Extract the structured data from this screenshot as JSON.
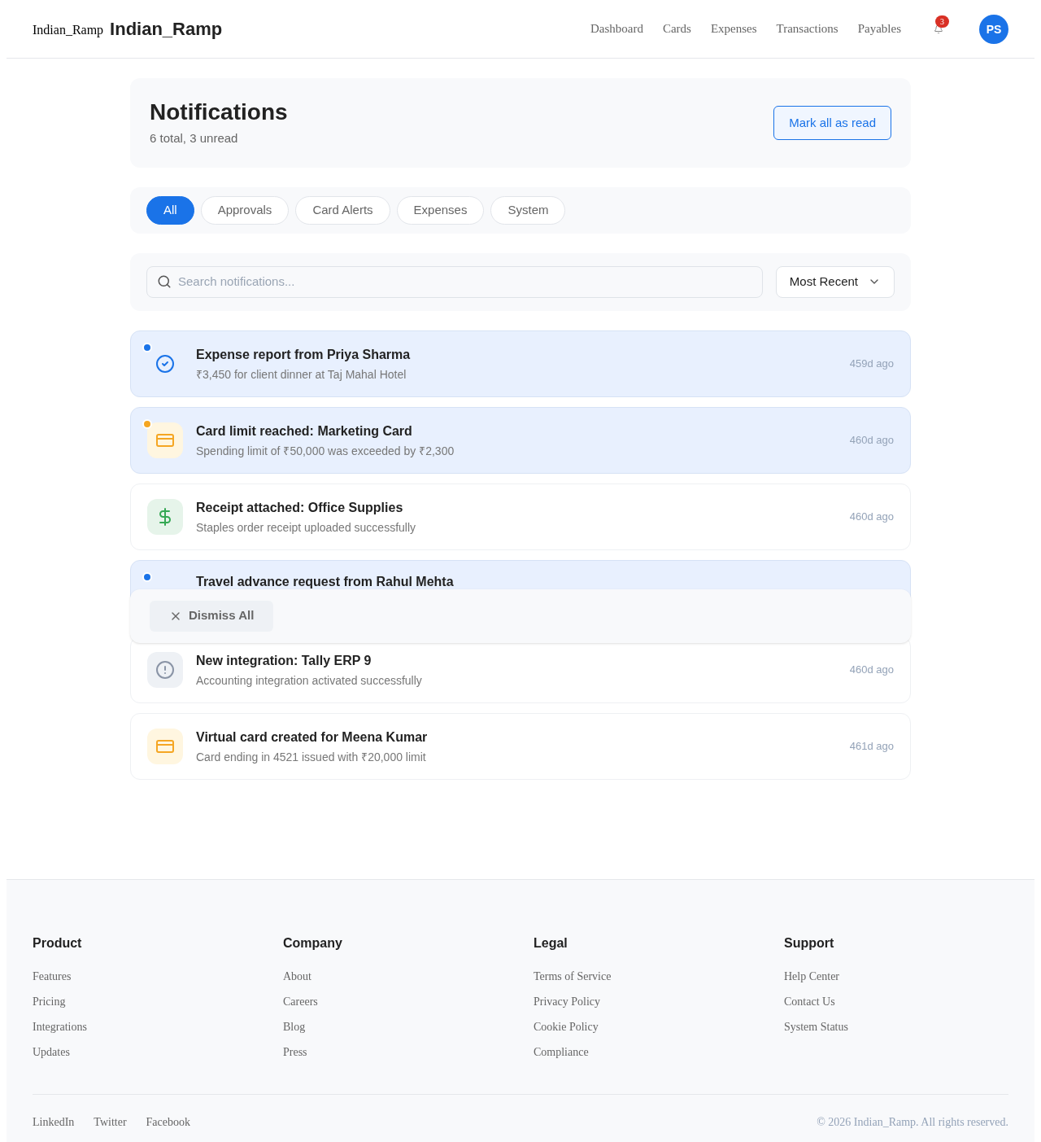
{
  "header": {
    "logo_alt": "Indian_Ramp",
    "brand": "Indian_Ramp",
    "nav": [
      "Dashboard",
      "Cards",
      "Expenses",
      "Transactions",
      "Payables"
    ],
    "notification_count": "3",
    "avatar": "PS"
  },
  "page": {
    "title": "Notifications",
    "subtitle": "6 total, 3 unread",
    "mark_all": "Mark all as read"
  },
  "filters": [
    {
      "label": "All",
      "selected": true
    },
    {
      "label": "Approvals",
      "selected": false
    },
    {
      "label": "Card Alerts",
      "selected": false
    },
    {
      "label": "Expenses",
      "selected": false
    },
    {
      "label": "System",
      "selected": false
    }
  ],
  "search": {
    "placeholder": "Search notifications..."
  },
  "sort": {
    "value": "Most Recent"
  },
  "notifications": [
    {
      "unread": true,
      "color": "#1a73e8",
      "kind": "check",
      "title": "Expense report from Priya Sharma",
      "description": "₹3,450 for client dinner at Taj Mahal Hotel",
      "time": "459d ago"
    },
    {
      "unread": true,
      "color": "#f5a623",
      "kind": "card",
      "title": "Card limit reached: Marketing Card",
      "description": "Spending limit of ₹50,000 was exceeded by ₹2,300",
      "time": "460d ago"
    },
    {
      "unread": false,
      "kind": "dollar",
      "title": "Receipt attached: Office Supplies",
      "description": "Staples order receipt uploaded successfully",
      "time": "460d ago"
    },
    {
      "unread": true,
      "color": "#1a73e8",
      "title": "Travel advance request from Rahul Mehta"
    },
    {
      "unread": false,
      "kind": "alert",
      "title": "New integration: Tally ERP 9",
      "description": "Accounting integration activated successfully",
      "time": "460d ago"
    },
    {
      "unread": false,
      "kind": "card",
      "title": "Virtual card created for Meena Kumar",
      "description": "Card ending in 4521 issued with ₹20,000 limit",
      "time": "461d ago"
    }
  ],
  "bulk_bar": {
    "dismiss": "Dismiss All"
  },
  "footer": {
    "columns": [
      {
        "heading": "Product",
        "links": [
          "Features",
          "Pricing",
          "Integrations",
          "Updates"
        ]
      },
      {
        "heading": "Company",
        "links": [
          "About",
          "Careers",
          "Blog",
          "Press"
        ]
      },
      {
        "heading": "Legal",
        "links": [
          "Terms of Service",
          "Privacy Policy",
          "Cookie Policy",
          "Compliance"
        ]
      },
      {
        "heading": "Support",
        "links": [
          "Help Center",
          "Contact Us",
          "System Status"
        ]
      }
    ],
    "social": [
      "LinkedIn",
      "Twitter",
      "Facebook"
    ],
    "copyright": "© 2026 Indian_Ramp. All rights reserved."
  }
}
